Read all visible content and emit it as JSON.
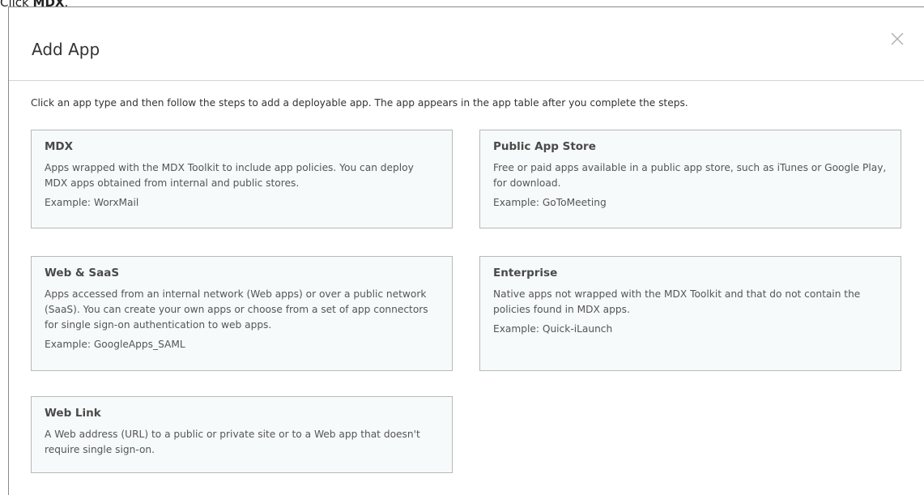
{
  "instruction": {
    "prefix": "Click ",
    "emphasis": "MDX",
    "suffix": "."
  },
  "dialog": {
    "title": "Add App",
    "close_icon": "close-icon",
    "intro": "Click an app type and then follow the steps to add a deployable app. The app appears in the app table after you complete the steps."
  },
  "cards": {
    "mdx": {
      "title": "MDX",
      "description": "Apps wrapped with the MDX Toolkit to include app policies. You can deploy MDX apps obtained from internal and public stores.",
      "example": "Example: WorxMail"
    },
    "public_app_store": {
      "title": "Public App Store",
      "description": "Free or paid apps available in a public app store, such as iTunes or Google Play, for download.",
      "example": "Example: GoToMeeting"
    },
    "web_saas": {
      "title": "Web & SaaS",
      "description": "Apps accessed from an internal network (Web apps) or over a public network (SaaS). You can create your own apps or choose from a set of app connectors for single sign-on authentication to web apps.",
      "example": "Example: GoogleApps_SAML"
    },
    "enterprise": {
      "title": "Enterprise",
      "description": "Native apps not wrapped with the MDX Toolkit and that do not contain the policies found in MDX apps.",
      "example": "Example: Quick-iLaunch"
    },
    "web_link": {
      "title": "Web Link",
      "description": "A Web address (URL) to a public or private site or to a Web app that doesn't require single sign-on."
    }
  },
  "colors": {
    "card_background": "#f7fafa",
    "card_border": "#b8b8b8",
    "header_divider": "#d4d4d4"
  }
}
